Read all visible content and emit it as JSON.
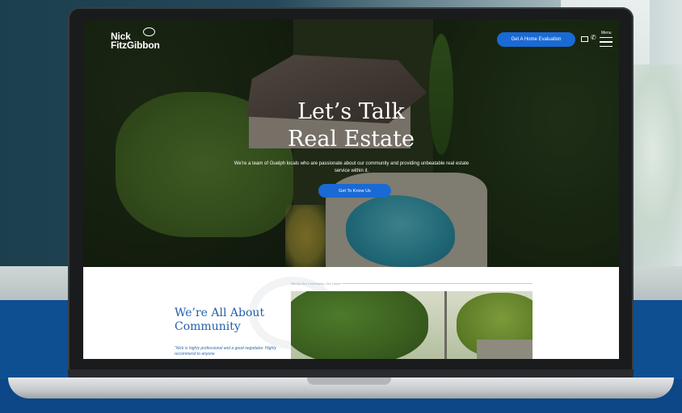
{
  "site": {
    "logo_line1": "Nick",
    "logo_line2": "FitzGibbon"
  },
  "header": {
    "cta_label": "Get A Home Evaluation",
    "menu_label": "Menu"
  },
  "hero": {
    "title_line1": "Let’s Talk",
    "title_line2": "Real Estate",
    "subtitle": "We’re a team of Guelph locals who are passionate about our community and providing unbeatable real estate service within it.",
    "button_label": "Get To Know Us"
  },
  "community": {
    "title": "We’re All About Community",
    "quote": "\"Nick is highly professional and a good negotiator. Highly recommend to anyone",
    "photo_caption": "We Do Our Community, Our Home"
  },
  "colors": {
    "accent": "#1a6ad6",
    "heading_blue": "#245ea8"
  },
  "icons": [
    "speech-bubble-icon",
    "mail-icon",
    "phone-icon",
    "menu-icon"
  ]
}
